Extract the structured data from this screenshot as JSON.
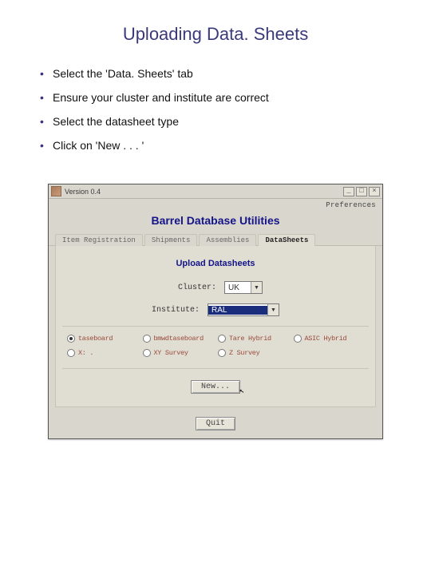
{
  "title": "Uploading Data. Sheets",
  "bullets": [
    "Select the 'Data. Sheets' tab",
    "Ensure your cluster and institute are correct",
    "Select the datasheet type",
    "Click on 'New . . . '"
  ],
  "window": {
    "title": "Version 0.4",
    "pref_link": "Preferences",
    "app_title": "Barrel Database Utilities",
    "tabs": {
      "t1": "Item Registration",
      "t2": "Shipments",
      "t3": "Assemblies",
      "t4": "DataSheets"
    },
    "section_title": "Upload Datasheets",
    "form": {
      "cluster_label": "Cluster:",
      "cluster_value": "UK",
      "institute_label": "Institute:",
      "institute_value": "RAL"
    },
    "radios": {
      "r1": "taseboard",
      "r2": "bmwdtaseboard",
      "r3": "Tare Hybrid",
      "r4": "ASIC Hybrid",
      "r5": "X: .",
      "r6": "XY Survey",
      "r7": "Z Survey"
    },
    "new_btn": "New...",
    "quit_btn": "Quit"
  }
}
